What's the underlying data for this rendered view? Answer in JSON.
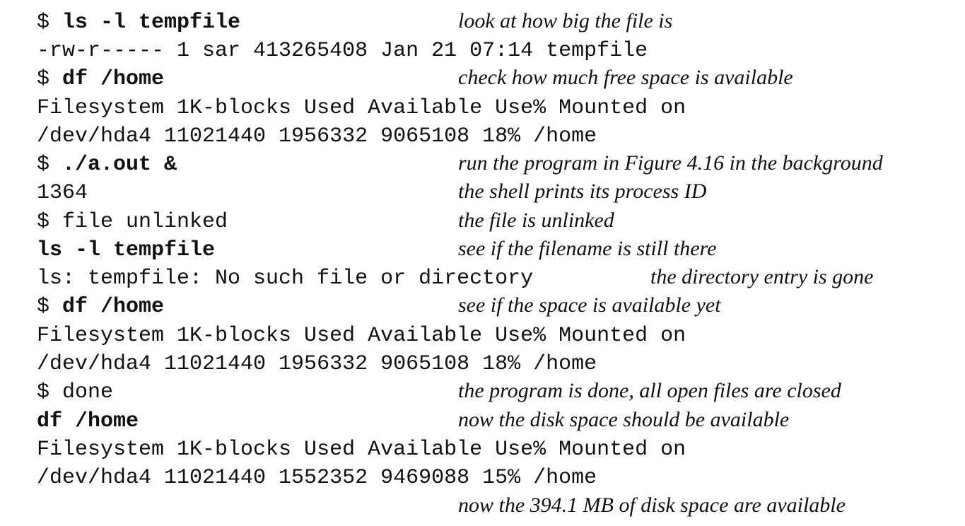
{
  "lines": [
    {
      "prompt": "$ ",
      "cmd": "ls -l tempfile",
      "text": "",
      "comment": "look at how big the file is"
    },
    {
      "prompt": "",
      "cmd": "",
      "text": "-rw-r----- 1 sar 413265408 Jan 21 07:14 tempfile",
      "comment": ""
    },
    {
      "prompt": "$ ",
      "cmd": "df /home",
      "text": "",
      "comment": "check how much free space is available"
    },
    {
      "prompt": "",
      "cmd": "",
      "text": "Filesystem 1K-blocks Used Available Use% Mounted on",
      "comment": ""
    },
    {
      "prompt": "",
      "cmd": "",
      "text": "/dev/hda4 11021440 1956332 9065108 18% /home",
      "comment": ""
    },
    {
      "prompt": "$ ",
      "cmd": "./a.out &",
      "text": "",
      "comment": "run the program in Figure 4.16 in the background"
    },
    {
      "prompt": "",
      "cmd": "",
      "text": "1364",
      "comment": "the shell prints its process ID"
    },
    {
      "prompt": "",
      "cmd": "",
      "text": "$ file unlinked",
      "comment": "the file is unlinked"
    },
    {
      "prompt": "",
      "cmd": "ls -l tempfile",
      "text": "",
      "comment": "see if the filename is still there"
    },
    {
      "prompt": "",
      "cmd": "",
      "text": "ls: tempfile: No such file or directory",
      "comment": "the directory entry is gone"
    },
    {
      "prompt": "$ ",
      "cmd": "df /home",
      "text": "",
      "comment": "see if the space is available yet"
    },
    {
      "prompt": "",
      "cmd": "",
      "text": "Filesystem 1K-blocks Used Available Use% Mounted on",
      "comment": ""
    },
    {
      "prompt": "",
      "cmd": "",
      "text": "/dev/hda4 11021440 1956332 9065108 18% /home",
      "comment": ""
    },
    {
      "prompt": "",
      "cmd": "",
      "text": "$ done",
      "comment": "the program is done, all open files are closed"
    },
    {
      "prompt": "",
      "cmd": "df /home",
      "text": "",
      "comment": "now the disk space should be available"
    },
    {
      "prompt": "",
      "cmd": "",
      "text": "Filesystem 1K-blocks Used Available Use% Mounted on",
      "comment": ""
    },
    {
      "prompt": "",
      "cmd": "",
      "text": "/dev/hda4 11021440 1552352 9469088 15% /home",
      "comment": ""
    },
    {
      "prompt": "",
      "cmd": "",
      "text": "",
      "comment": "now the 394.1 MB of disk space are available"
    }
  ]
}
